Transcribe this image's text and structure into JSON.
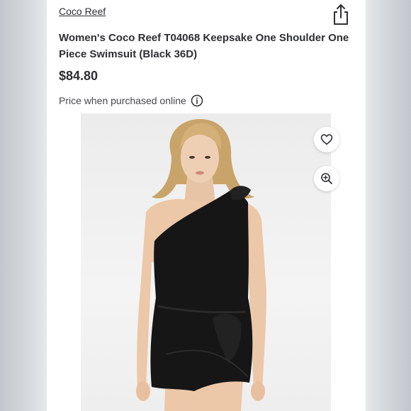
{
  "product": {
    "brand": "Coco Reef",
    "title": "Women's Coco Reef T04068 Keepsake One Shoulder One Piece Swimsuit (Black 36D)",
    "price": "$84.80",
    "price_note": "Price when purchased online"
  },
  "icons": {
    "share": "share-icon",
    "info": "info-icon",
    "favorite": "heart-icon",
    "zoom": "zoom-in-icon"
  },
  "colors": {
    "text": "#2e2f32",
    "swimsuit": "#161616"
  }
}
